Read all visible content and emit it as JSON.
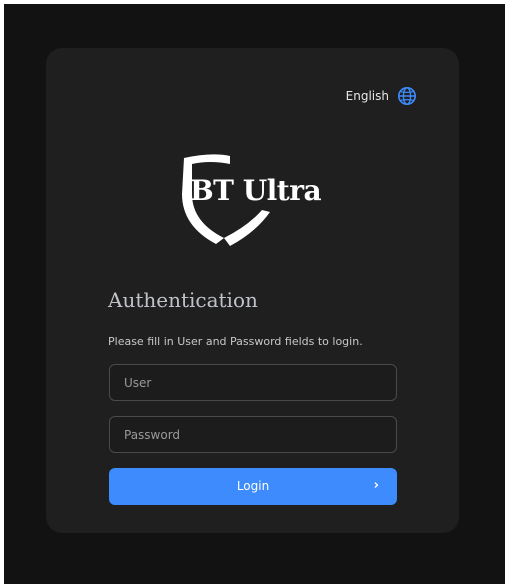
{
  "language": {
    "label": "English",
    "icon": "globe-icon",
    "icon_color": "#3d8bfd"
  },
  "logo": {
    "text": "BT Ultra",
    "icon": "shield-icon"
  },
  "auth": {
    "title": "Authentication",
    "subtitle": "Please fill in User and Password fields to login."
  },
  "form": {
    "user_placeholder": "User",
    "password_placeholder": "Password",
    "login_label": "Login",
    "login_chevron": "›",
    "accent_color": "#3d8bfd"
  }
}
